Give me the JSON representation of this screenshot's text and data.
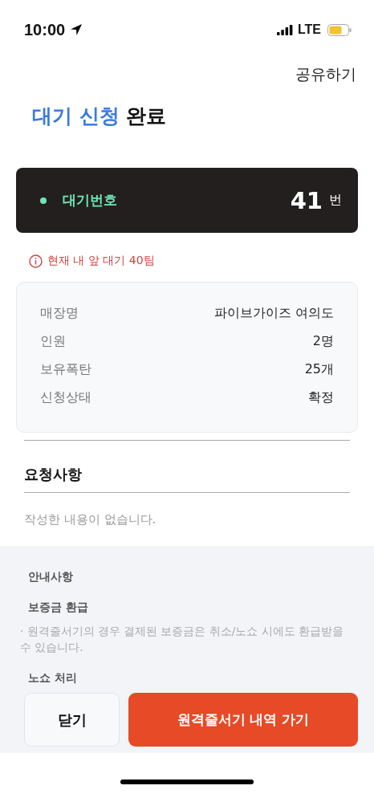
{
  "status_bar": {
    "time": "10:00",
    "network": "LTE"
  },
  "header": {
    "share": "공유하기"
  },
  "title": {
    "highlight": "대기 신청",
    "rest": "완료"
  },
  "queue_card": {
    "label": "대기번호",
    "number": "41",
    "unit": "번"
  },
  "notice": "현재 내 앞 대기 40팀",
  "details": [
    {
      "label": "매장명",
      "value": "파이브가이즈 여의도"
    },
    {
      "label": "인원",
      "value": "2명"
    },
    {
      "label": "보유폭탄",
      "value": "25개"
    },
    {
      "label": "신청상태",
      "value": "확정"
    }
  ],
  "request": {
    "heading": "요청사항",
    "placeholder": "작성한 내용이 없습니다."
  },
  "guide": {
    "heading": "안내사항",
    "sections": [
      {
        "title": "보증금 환급",
        "body": "· 원격줄서기의 경우 결제된 보증금은 취소/노쇼 시에도 환급받을 수 있습니다."
      },
      {
        "title": "노쇼 처리"
      }
    ]
  },
  "buttons": {
    "close": "닫기",
    "primary": "원격줄서기 내역 가기"
  }
}
